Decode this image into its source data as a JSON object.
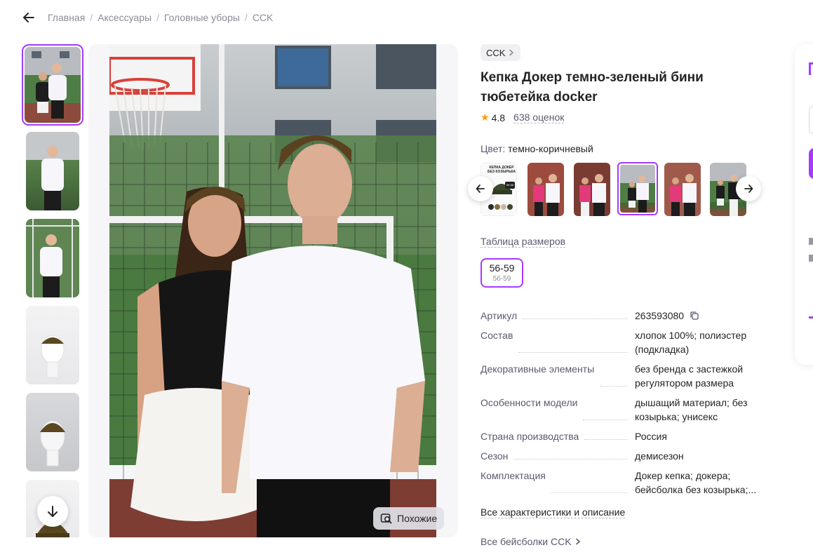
{
  "breadcrumb": {
    "items": [
      "Главная",
      "Аксессуары",
      "Головные уборы",
      "CCK"
    ],
    "separator": "/"
  },
  "icons": {
    "back": "arrow-left-icon",
    "thumbs_down": "arrow-down-icon",
    "similar": "similar-search-icon",
    "brand_chevron": "chevron-right-icon",
    "star": "star-icon",
    "prev": "arrow-left-icon",
    "next": "arrow-right-icon",
    "copy": "copy-icon"
  },
  "gallery": {
    "similar_label": "Похожие"
  },
  "product": {
    "brand": "CCK",
    "title": "Кепка Докер темно-зеленый бини тюбетейка docker",
    "rating": "4.8",
    "reviews": "638 оценок",
    "color_label": "Цвет:",
    "color_value": "темно-коричневый",
    "size_table_link": "Таблица размеров",
    "size": {
      "label": "56-59",
      "sub": "56-59"
    },
    "variant_preview": {
      "line1": "КЕПКА ДОКЕР",
      "line2": "БЕЗ КОЗЫРЬКА",
      "size": "56-58"
    },
    "specs": [
      {
        "key": "Артикул",
        "value": "263593080"
      },
      {
        "key": "Состав",
        "value": "хлопок 100%; полиэстер (подкладка)"
      },
      {
        "key": "Декоративные элементы",
        "value": "без бренда с застежкой регулятором размера"
      },
      {
        "key": "Особенности модели",
        "value": "дышащий материал; без козырька; унисекс"
      },
      {
        "key": "Страна производства",
        "value": "Россия"
      },
      {
        "key": "Сезон",
        "value": "демисезон"
      },
      {
        "key": "Комплектация",
        "value": "Докер кепка; докера; бейсболка без козырька;..."
      }
    ],
    "all_characteristics": "Все характеристики и описание",
    "all_brand_caps": "Все бейсболки CCK"
  },
  "colors": {
    "accent": "#a73afd",
    "text_primary": "#242424",
    "text_secondary": "#595970",
    "star": "#ff9d00"
  }
}
